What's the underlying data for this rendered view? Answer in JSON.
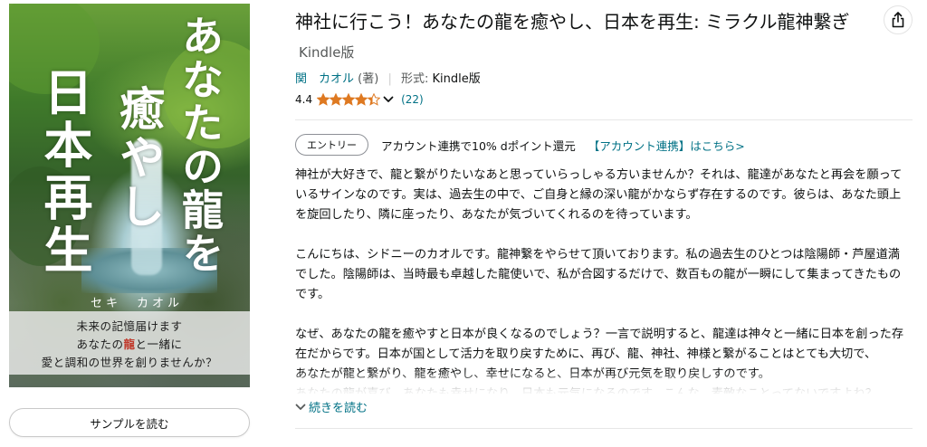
{
  "book": {
    "title": "神社に行こう！あなたの龍を癒やし、日本を再生: ミラクル龍神繋ぎ",
    "format_label": "Kindle版",
    "author_name": "関　カオル",
    "author_role": "(著)",
    "format_prefix": "形式:",
    "format_value": "Kindle版"
  },
  "rating": {
    "score": "4.4",
    "stars": 4.4,
    "count": "(22)",
    "star_color": "#de7921"
  },
  "promo": {
    "badge": "エントリー",
    "text": "アカウント連携で10% dポイント還元",
    "link": "【アカウント連携】はこちら>"
  },
  "description": {
    "paragraphs": [
      "神社が大好きで、龍と繋がりたいなあと思っていらっしゃる方いませんか？それは、龍達があなたと再会を願っているサインなのです。実は、過去生の中で、ご自身と縁の深い龍がかならず存在するのです。彼らは、あなた頭上を旋回したり、隣に座ったり、あなたが気づいてくれるのを待っています。",
      "こんにちは、シドニーのカオルです。龍神繋をやらせて頂いております。私の過去生のひとつは陰陽師・芦屋道満でした。陰陽師は、当時最も卓越した龍使いで、私が合図するだけで、数百もの龍が一瞬にして集まってきたものです。",
      "なぜ、あなたの龍を癒やすと日本が良くなるのでしょう？一言で説明すると、龍達は神々と一緒に日本を創った存在だからです。日本が国として活力を取り戻すために、再び、龍、神社、神様と繋がることはとても大切で、\nあなたが龍と繋がり、龍を癒やし、幸せになると、日本が再び元気を取り戻しすのです。\nあなたの龍が喜び、あなたも幸せになり、日本も元気になるのです。こんな、素敵なことってないですよね？"
    ],
    "read_more": "続きを読む"
  },
  "cover": {
    "title_col1": "あなたの龍を",
    "title_col2": "癒やし",
    "title_col3": "日本再生",
    "author": "セキ　カオル",
    "band_line1": "未来の記憶届けます",
    "band_line2_a": "あなたの",
    "band_line2_red": "龍",
    "band_line2_b": "と一緒に",
    "band_line3": "愛と調和の世界を創りませんか？"
  },
  "actions": {
    "sample": "サンプルを読む"
  },
  "icons": {
    "share": "share-icon",
    "chevron": "chevron-down-icon"
  },
  "colors": {
    "link": "#007185",
    "text": "#0f1111",
    "muted": "#565959"
  }
}
